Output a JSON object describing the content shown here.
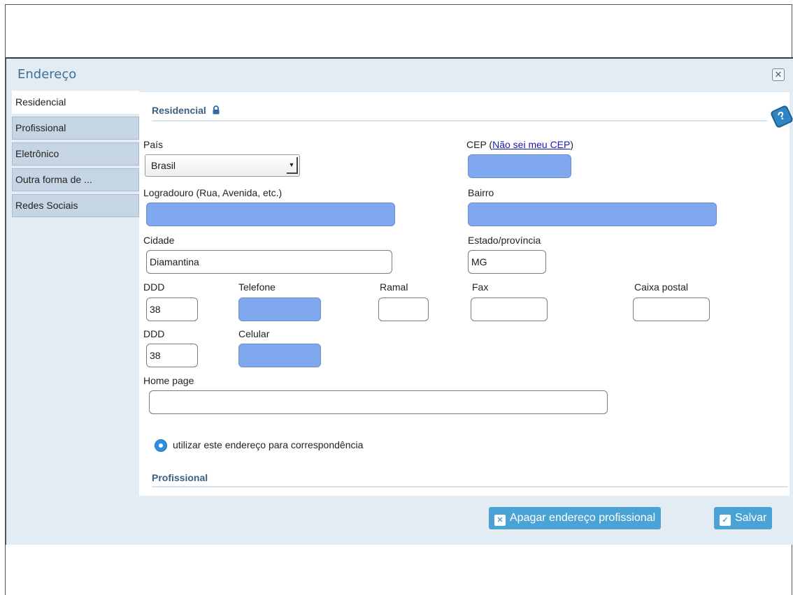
{
  "dialog": {
    "title": "Endereço",
    "close_glyph": "✕"
  },
  "tabs": [
    {
      "label": "Residencial",
      "active": true
    },
    {
      "label": "Profissional",
      "active": false
    },
    {
      "label": "Eletrônico",
      "active": false
    },
    {
      "label": "Outra forma de ...",
      "active": false
    },
    {
      "label": "Redes Sociais",
      "active": false
    }
  ],
  "section": {
    "title": "Residencial",
    "lock_icon": "lock-icon",
    "help_glyph": "?",
    "next_title": "Profissional"
  },
  "form": {
    "pais_label": "País",
    "pais_value": "Brasil",
    "cep_label": "CEP (",
    "cep_link": "Não sei meu CEP",
    "cep_label_end": ")",
    "cep_value": "",
    "logradouro_label": "Logradouro (Rua, Avenida, etc.)",
    "logradouro_value": "",
    "bairro_label": "Bairro",
    "bairro_value": "",
    "cidade_label": "Cidade",
    "cidade_value": "Diamantina",
    "estado_label": "Estado/província",
    "estado_value": "MG",
    "ddd_label": "DDD",
    "ddd_value": "38",
    "telefone_label": "Telefone",
    "telefone_value": "",
    "ramal_label": "Ramal",
    "ramal_value": "",
    "fax_label": "Fax",
    "fax_value": "",
    "caixa_label": "Caixa postal",
    "caixa_value": "",
    "ddd2_label": "DDD",
    "ddd2_value": "38",
    "celular_label": "Celular",
    "celular_value": "",
    "homepage_label": "Home page",
    "homepage_value": "",
    "correspondencia_label": "utilizar este endereço para correspondência"
  },
  "buttons": {
    "apagar_label": "Apagar endereço profissional",
    "salvar_label": "Salvar"
  },
  "colors": {
    "required_field": "#7fa8ee",
    "accent": "#4aa3d4",
    "title": "#3d6f96"
  }
}
